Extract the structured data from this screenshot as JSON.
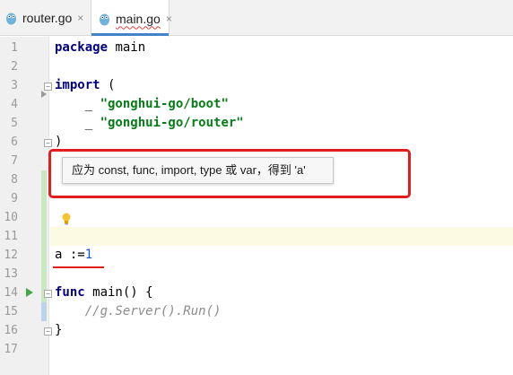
{
  "tabs": [
    {
      "label": "router.go",
      "close": "×"
    },
    {
      "label": "main.go",
      "close": "×"
    }
  ],
  "line_numbers": [
    "1",
    "2",
    "3",
    "4",
    "5",
    "6",
    "7",
    "8",
    "9",
    "10",
    "11",
    "12",
    "13",
    "14",
    "15",
    "16",
    "17"
  ],
  "code": {
    "l1_kw": "package",
    "l1_rest": " main",
    "l3_kw": "import",
    "l3_rest": " (",
    "l4_pre": "    _ ",
    "l4_str": "\"gonghui-go/boot\"",
    "l5_pre": "    _ ",
    "l5_str": "\"gonghui-go/router\"",
    "l6": ")",
    "l12_pre": "a :=",
    "l12_num": "1",
    "l14_kw": "func",
    "l14_rest": " main() {",
    "l15_cmt": "    //g.Server().Run()",
    "l16": "}"
  },
  "tooltip": {
    "message": "应为 const, func, import, type 或 var，得到 'a'"
  },
  "colors": {
    "accent": "#4083c9",
    "annotation_red": "#e01e1e",
    "keyword": "#000080",
    "string": "#067d17",
    "number": "#1750eb"
  }
}
